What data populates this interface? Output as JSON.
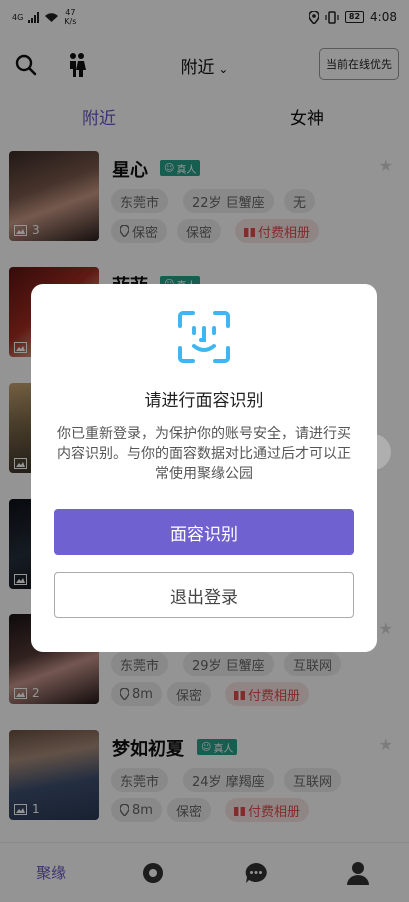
{
  "status_bar": {
    "network": "4G",
    "speed_value": "47",
    "speed_unit": "K/s",
    "battery": "82",
    "time": "4:08"
  },
  "header": {
    "location": "附近",
    "priority_button": "当前在线优先"
  },
  "tabs": [
    {
      "label": "附近",
      "active": true
    },
    {
      "label": "女神",
      "active": false
    }
  ],
  "cards": [
    {
      "name": "星心",
      "verified": "真人",
      "tags": [
        "东莞市",
        "22岁 巨蟹座",
        "无"
      ],
      "extra": [
        "保密",
        "保密",
        "付费相册"
      ],
      "photo_count": "3"
    },
    {
      "name": "菲菲",
      "verified": "真人",
      "tags": [],
      "extra": [],
      "photo_count": ""
    },
    {
      "name": "",
      "verified": "",
      "tags": [],
      "extra": [],
      "photo_count": ""
    },
    {
      "name": "",
      "verified": "",
      "tags": [],
      "extra": [],
      "photo_count": ""
    },
    {
      "name": "",
      "verified": "",
      "tags": [
        "东莞市",
        "29岁 巨蟹座",
        "互联网"
      ],
      "extra": [
        "8m",
        "保密",
        "付费相册"
      ],
      "photo_count": "2"
    },
    {
      "name": "梦如初夏",
      "verified": "真人",
      "tags": [
        "东莞市",
        "24岁 摩羯座",
        "互联网"
      ],
      "extra": [
        "8m",
        "保密",
        "付费相册"
      ],
      "photo_count": "1"
    }
  ],
  "dialog": {
    "title": "请进行面容识别",
    "body": "你已重新登录，为保护你的账号安全，请进行买内容识别。与你的面容数据对比通过后才可以正常使用聚缘公园",
    "primary_button": "面容识别",
    "secondary_button": "退出登录"
  },
  "bottom_nav": [
    {
      "label": "聚缘",
      "icon": "home-text",
      "active": true
    },
    {
      "label": "",
      "icon": "discover-icon",
      "active": false
    },
    {
      "label": "",
      "icon": "chat-icon",
      "active": false
    },
    {
      "label": "",
      "icon": "profile-icon",
      "active": false
    }
  ],
  "colors": {
    "accent": "#7061d1",
    "verified": "#27a28a",
    "paid": "#e34b4b",
    "face_icon": "#3fb6f0"
  }
}
